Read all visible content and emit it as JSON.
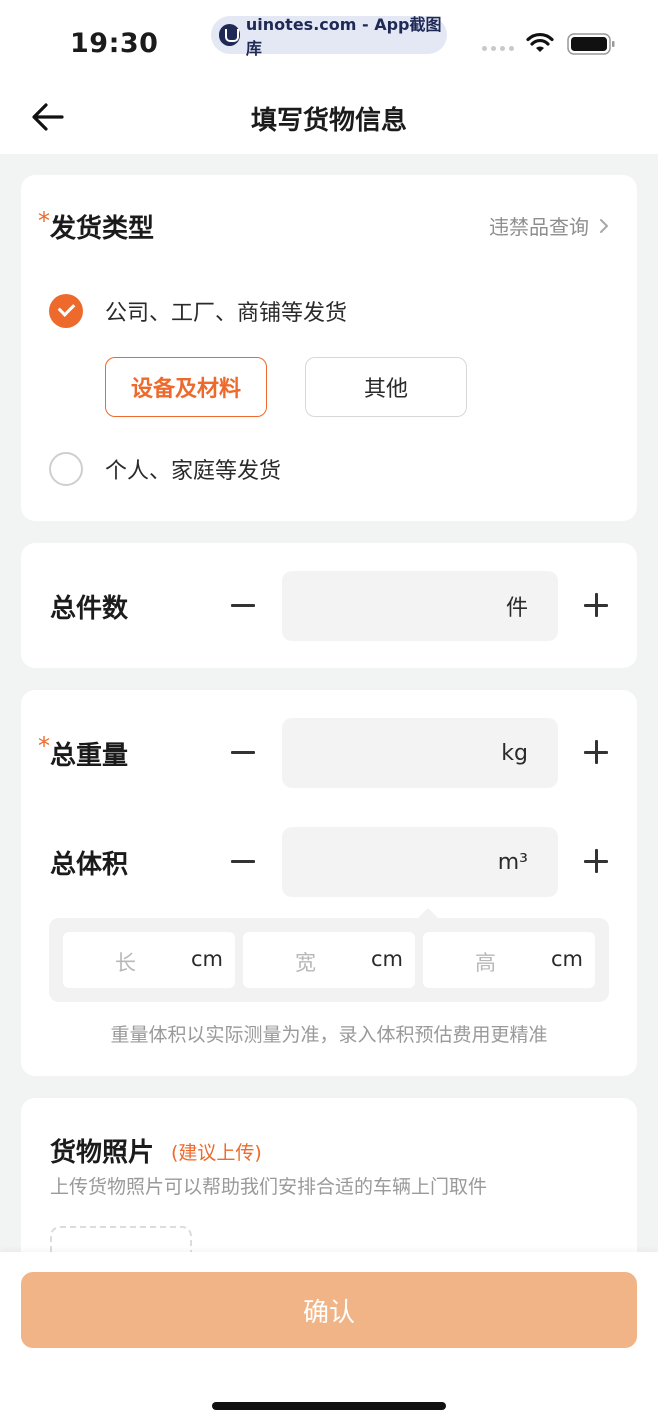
{
  "status": {
    "time": "19:30",
    "watermark": "uinotes.com - App截图库"
  },
  "nav": {
    "title": "填写货物信息"
  },
  "shipping_type": {
    "required_mark": "*",
    "title": "发货类型",
    "prohibited_link": "违禁品查询",
    "options": [
      {
        "label": "公司、工厂、商铺等发货",
        "checked": true
      },
      {
        "label": "个人、家庭等发货",
        "checked": false
      }
    ],
    "chips": [
      {
        "label": "设备及材料",
        "active": true
      },
      {
        "label": "其他",
        "active": false
      }
    ]
  },
  "count": {
    "label": "总件数",
    "unit": "件"
  },
  "weight": {
    "required_mark": "*",
    "label": "总重量",
    "unit": "kg"
  },
  "volume": {
    "label": "总体积",
    "unit": "m³",
    "dims": [
      {
        "placeholder": "长",
        "unit": "cm"
      },
      {
        "placeholder": "宽",
        "unit": "cm"
      },
      {
        "placeholder": "高",
        "unit": "cm"
      }
    ],
    "hint": "重量体积以实际测量为准，录入体积预估费用更精准"
  },
  "photos": {
    "title": "货物照片",
    "suggest": "(建议上传)",
    "desc": "上传货物照片可以帮助我们安排合适的车辆上门取件"
  },
  "footer": {
    "confirm_label": "确认"
  },
  "colors": {
    "accent": "#ee6a2c",
    "confirm_disabled": "#f0b486",
    "background": "#f2f3f3"
  }
}
